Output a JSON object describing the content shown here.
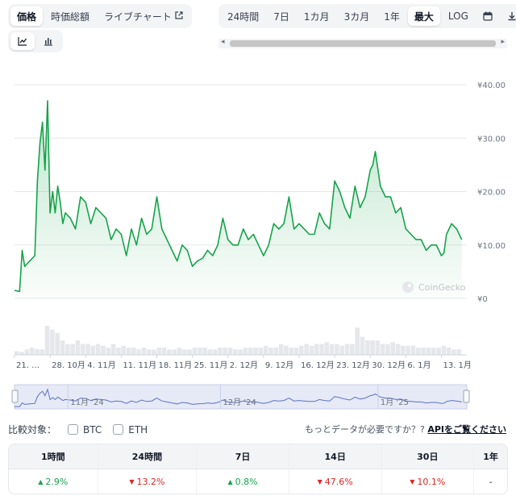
{
  "tabs": [
    "価格",
    "時価総額",
    "ライブチャート"
  ],
  "external_icon": "external-link-icon",
  "ranges": [
    "24時間",
    "7日",
    "1カ月",
    "3カ月",
    "1年",
    "最大",
    "LOG"
  ],
  "active_range": "最大",
  "range_icons": [
    "calendar-icon",
    "download-icon"
  ],
  "chart_types": [
    "line-chart-icon",
    "bar-chart-icon"
  ],
  "watermark": "CoinGecko",
  "compare": {
    "label": "比較対象：",
    "options": [
      "BTC",
      "ETH"
    ]
  },
  "need_data": {
    "text": "もっとデータが必要ですか？?",
    "link": "APIをご覧ください"
  },
  "changes": {
    "headers": [
      "1時間",
      "24時間",
      "7日",
      "14日",
      "30日",
      "1年"
    ],
    "values": [
      {
        "text": "2.9%",
        "dir": "up"
      },
      {
        "text": "13.2%",
        "dir": "down"
      },
      {
        "text": "0.8%",
        "dir": "up"
      },
      {
        "text": "47.6%",
        "dir": "down"
      },
      {
        "text": "10.1%",
        "dir": "down"
      },
      {
        "text": "-",
        "dir": "none"
      }
    ]
  },
  "chart_data": {
    "type": "area",
    "y_ticks": [
      "¥40.00",
      "¥30.00",
      "¥20.00",
      "¥10.00",
      "¥0"
    ],
    "y_tick_values": [
      40,
      30,
      20,
      10,
      0
    ],
    "ylim": [
      0,
      40
    ],
    "x_tick_labels": [
      "21. …",
      "28. 10月",
      "4. 11月",
      "11. 11月",
      "18. 11月",
      "25. 11月",
      "2. 12月",
      "9. 12月",
      "16. 12月",
      "23. 12月",
      "30. 12月",
      "6. 1月",
      "13. 1月"
    ],
    "x_tick_days": [
      0,
      7,
      14,
      21,
      28,
      35,
      42,
      49,
      56,
      63,
      70,
      77,
      84
    ],
    "x_range_days": [
      0,
      89
    ],
    "navigator_labels": [
      "11月 '24",
      "12月 '24",
      "1月 '25"
    ],
    "navigator_label_days": [
      11,
      41,
      72
    ],
    "series": [
      {
        "x": [
          0,
          1,
          1.5,
          2,
          3,
          4,
          4.5,
          5,
          5.5,
          6,
          6.5,
          7,
          7.5,
          8,
          8.5,
          9,
          9.5,
          10,
          11,
          12,
          13,
          14,
          15,
          16,
          17,
          18,
          19,
          20,
          21,
          22,
          23,
          24,
          25,
          26,
          27,
          28,
          29,
          30,
          31,
          32,
          33,
          34,
          35,
          36,
          37,
          38,
          39,
          40,
          41,
          42,
          43,
          44,
          45,
          46,
          47,
          48,
          49,
          50,
          51,
          52,
          53,
          54,
          55,
          56,
          57,
          58,
          59,
          60,
          61,
          62,
          63,
          64,
          65,
          66,
          67,
          68,
          69,
          70,
          70.5,
          71,
          72,
          73,
          74,
          75,
          76,
          77,
          78,
          79,
          80,
          81,
          82,
          83,
          84,
          84.5,
          85,
          86,
          87,
          88
        ],
        "values": [
          1.5,
          1.3,
          9,
          6,
          7,
          8,
          22,
          29,
          33,
          24,
          37,
          16,
          20,
          16,
          21,
          18,
          14,
          16,
          15,
          13,
          19,
          18,
          14,
          17,
          16,
          15,
          11,
          13,
          12,
          8,
          13,
          10,
          15,
          12,
          13,
          19,
          13,
          11,
          9,
          7,
          10,
          9,
          6,
          7,
          7.5,
          9,
          8,
          10,
          15,
          11,
          10,
          10,
          13,
          11,
          12,
          10,
          8,
          10,
          14,
          13,
          14,
          19,
          13,
          14,
          13,
          12,
          12,
          16,
          14,
          13,
          22,
          20,
          17,
          15,
          21,
          17,
          19,
          24,
          25,
          27.5,
          21,
          19,
          19,
          16,
          17,
          13,
          12,
          11,
          11,
          9,
          10,
          10,
          8,
          8.5,
          12,
          14,
          13,
          11
        ]
      }
    ],
    "volume_bars": [
      1,
      0.8,
      1.5,
      2,
      1.6,
      1.5,
      8,
      7,
      6,
      4,
      3,
      3,
      4,
      3,
      3,
      2.5,
      3,
      2.5,
      2,
      3,
      2,
      2.5,
      2,
      2,
      1.5,
      2,
      1.5,
      1.5,
      2,
      2,
      1.5,
      1.5,
      2,
      1.5,
      1.5,
      2,
      2,
      2,
      1.5,
      1.5,
      2,
      2,
      2,
      1.5,
      1.5,
      2,
      2,
      2,
      2,
      2.5,
      2,
      2,
      3,
      2.5,
      2,
      2,
      2.5,
      3,
      2.5,
      3,
      3,
      3.5,
      3,
      3,
      2.5,
      3,
      3,
      7.5,
      5,
      4,
      4,
      4,
      3,
      3,
      3.5,
      3,
      2.5,
      2.5,
      2.5,
      2,
      2,
      2,
      2,
      2,
      2.5,
      2,
      1.5,
      1.5
    ]
  }
}
